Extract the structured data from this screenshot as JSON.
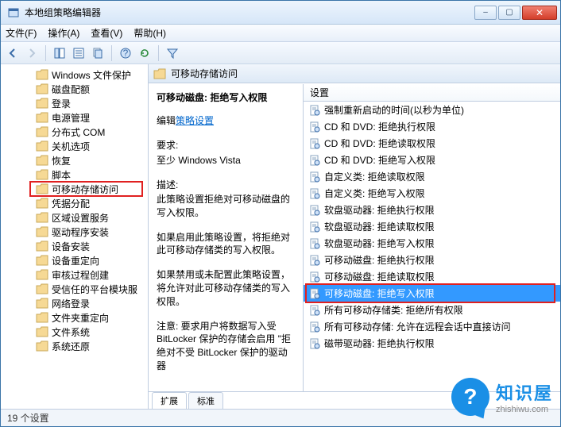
{
  "window": {
    "title": "本地组策略编辑器"
  },
  "menu": {
    "file": "文件(F)",
    "action": "操作(A)",
    "view": "查看(V)",
    "help": "帮助(H)"
  },
  "tree": {
    "items": [
      {
        "label": "Windows 文件保护"
      },
      {
        "label": "磁盘配额"
      },
      {
        "label": "登录"
      },
      {
        "label": "电源管理"
      },
      {
        "label": "分布式 COM"
      },
      {
        "label": "关机选项"
      },
      {
        "label": "恢复"
      },
      {
        "label": "脚本"
      },
      {
        "label": "可移动存储访问",
        "highlight": true
      },
      {
        "label": "凭据分配"
      },
      {
        "label": "区域设置服务"
      },
      {
        "label": "驱动程序安装"
      },
      {
        "label": "设备安装"
      },
      {
        "label": "设备重定向"
      },
      {
        "label": "审核过程创建"
      },
      {
        "label": "受信任的平台模块服"
      },
      {
        "label": "网络登录"
      },
      {
        "label": "文件夹重定向"
      },
      {
        "label": "文件系统"
      },
      {
        "label": "系统还原"
      }
    ]
  },
  "content": {
    "header": "可移动存储访问",
    "desc": {
      "title": "可移动磁盘: 拒绝写入权限",
      "edit_label": "编辑",
      "edit_link": "策略设置",
      "req_label": "要求:",
      "req_value": "至少 Windows Vista",
      "desc_label": "描述:",
      "desc_p1": "此策略设置拒绝对可移动磁盘的写入权限。",
      "desc_p2": "如果启用此策略设置，将拒绝对此可移动存储类的写入权限。",
      "desc_p3": "如果禁用或未配置此策略设置，将允许对此可移动存储类的写入权限。",
      "desc_p4": "注意: 要求用户将数据写入受 BitLocker 保护的存储会启用 \"拒绝对不受 BitLocker 保护的驱动器"
    },
    "tabs": {
      "extended": "扩展",
      "standard": "标准"
    },
    "settings": {
      "header": "设置",
      "items": [
        {
          "label": "强制重新启动的时间(以秒为单位)"
        },
        {
          "label": "CD 和 DVD: 拒绝执行权限"
        },
        {
          "label": "CD 和 DVD: 拒绝读取权限"
        },
        {
          "label": "CD 和 DVD: 拒绝写入权限"
        },
        {
          "label": "自定义类: 拒绝读取权限"
        },
        {
          "label": "自定义类: 拒绝写入权限"
        },
        {
          "label": "软盘驱动器: 拒绝执行权限"
        },
        {
          "label": "软盘驱动器: 拒绝读取权限"
        },
        {
          "label": "软盘驱动器: 拒绝写入权限"
        },
        {
          "label": "可移动磁盘: 拒绝执行权限"
        },
        {
          "label": "可移动磁盘: 拒绝读取权限"
        },
        {
          "label": "可移动磁盘: 拒绝写入权限",
          "selected": true
        },
        {
          "label": "所有可移动存储类: 拒绝所有权限"
        },
        {
          "label": "所有可移动存储: 允许在远程会话中直接访问"
        },
        {
          "label": "磁带驱动器: 拒绝执行权限"
        }
      ]
    }
  },
  "status": {
    "text": "19 个设置"
  },
  "watermark": {
    "name": "知识屋",
    "domain": "zhishiwu.com",
    "glyph": "?"
  }
}
